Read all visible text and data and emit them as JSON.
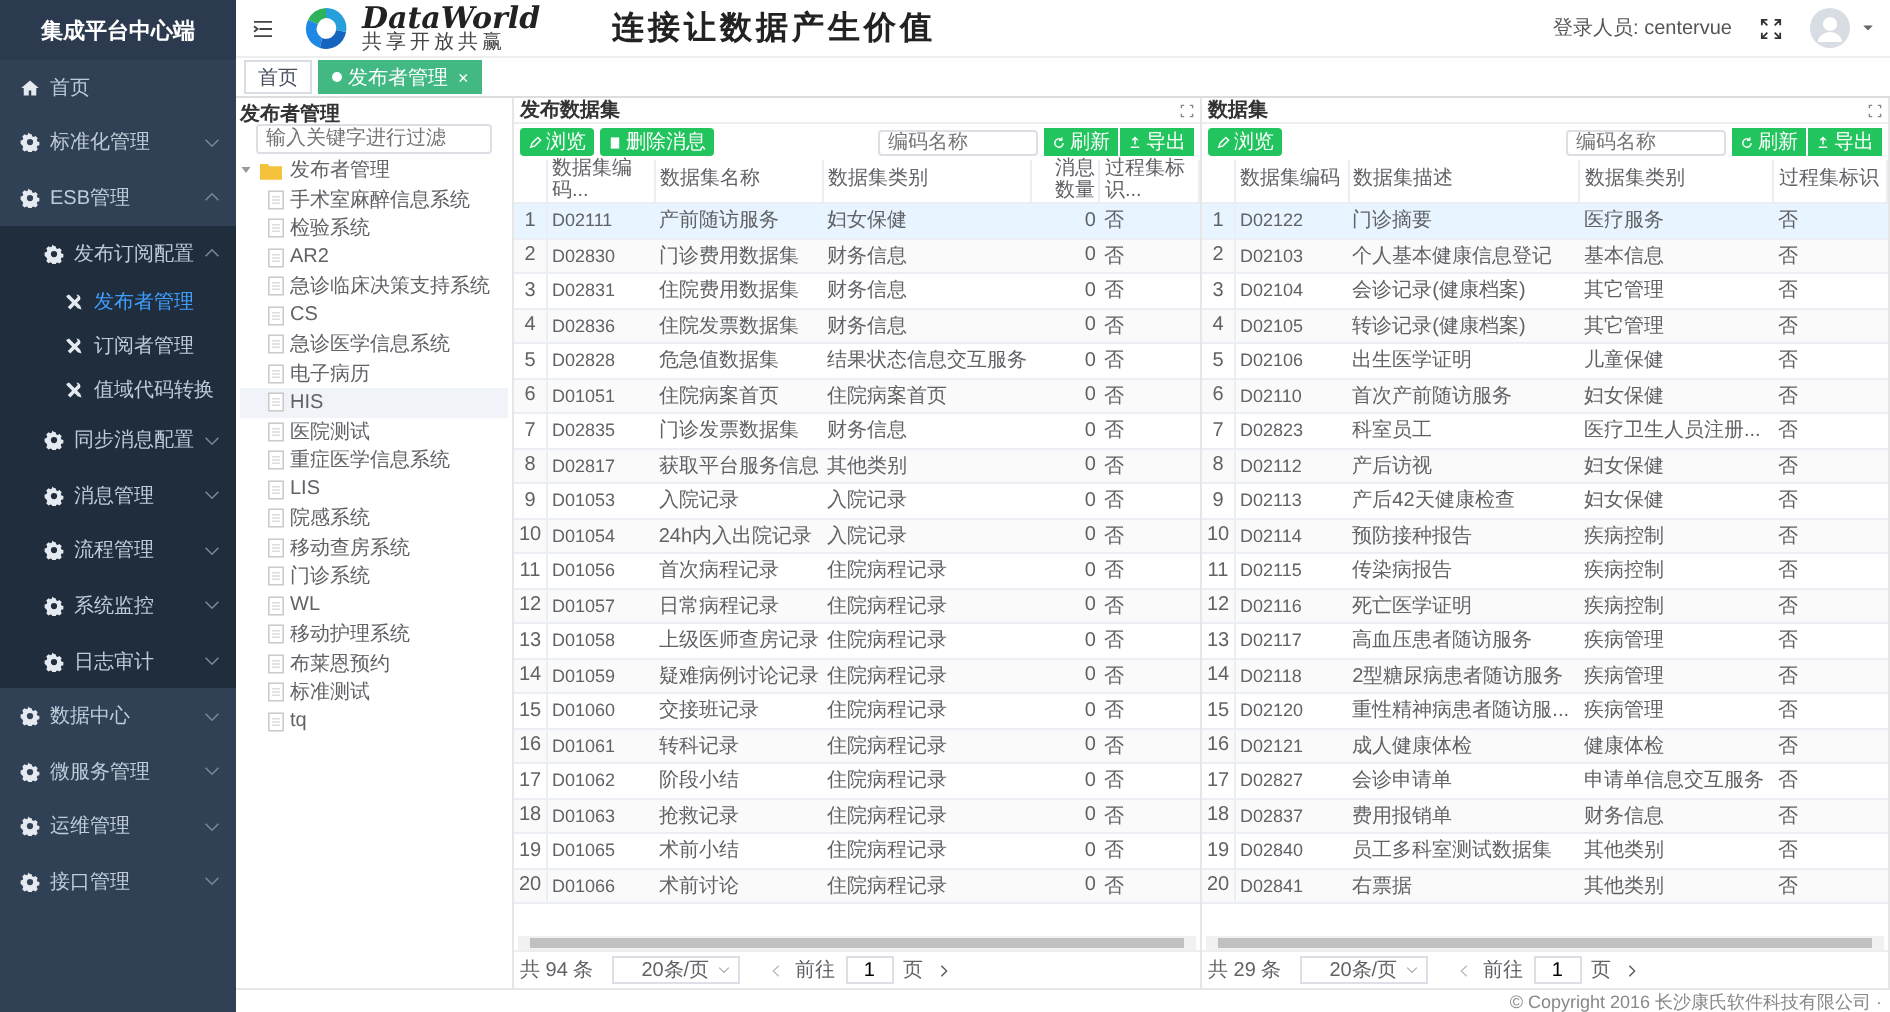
{
  "sidebar": {
    "title": "集成平台中心端",
    "items": [
      {
        "label": "首页",
        "kind": "leaf",
        "selected": false
      },
      {
        "label": "标准化管理",
        "kind": "group",
        "expanded": false,
        "selected": false
      },
      {
        "label": "ESB管理",
        "kind": "group",
        "expanded": true,
        "selected": false,
        "children": [
          {
            "label": "发布订阅配置",
            "kind": "group",
            "expanded": true,
            "selected": false,
            "children": [
              {
                "label": "发布者管理",
                "kind": "leaf",
                "selected": true
              },
              {
                "label": "订阅者管理",
                "kind": "leaf",
                "selected": false
              },
              {
                "label": "值域代码转换",
                "kind": "leaf",
                "selected": false
              }
            ]
          },
          {
            "label": "同步消息配置",
            "kind": "group",
            "expanded": false,
            "selected": false
          },
          {
            "label": "消息管理",
            "kind": "group",
            "expanded": false,
            "selected": false
          },
          {
            "label": "流程管理",
            "kind": "group",
            "expanded": false,
            "selected": false
          },
          {
            "label": "系统监控",
            "kind": "group",
            "expanded": false,
            "selected": false
          },
          {
            "label": "日志审计",
            "kind": "group",
            "expanded": false,
            "selected": false
          }
        ]
      },
      {
        "label": "数据中心",
        "kind": "group",
        "expanded": false,
        "selected": false
      },
      {
        "label": "微服务管理",
        "kind": "group",
        "expanded": false,
        "selected": false
      },
      {
        "label": "运维管理",
        "kind": "group",
        "expanded": false,
        "selected": false
      },
      {
        "label": "接口管理",
        "kind": "group",
        "expanded": false,
        "selected": false
      }
    ]
  },
  "header": {
    "logo_text": "DataWorld",
    "logo_subtitle": "共享开放共赢",
    "slogan": "连接让数据产生价值",
    "user_label": "登录人员: centervue"
  },
  "tabs": [
    {
      "label": "首页",
      "selected": false
    },
    {
      "label": "发布者管理",
      "selected": true,
      "close": "×"
    }
  ],
  "tree_panel": {
    "title": "发布者管理",
    "search": {
      "placeholder": "输入关键字进行过滤"
    },
    "tree": [
      {
        "label": "发布者管理",
        "expanded": true,
        "selected": false,
        "children": [
          {
            "label": "手术室麻醉信息系统",
            "selected": false
          },
          {
            "label": "检验系统",
            "selected": false
          },
          {
            "label": "AR2",
            "selected": false
          },
          {
            "label": "急诊临床决策支持系统",
            "selected": false
          },
          {
            "label": "CS",
            "selected": false
          },
          {
            "label": "急诊医学信息系统",
            "selected": false
          },
          {
            "label": "电子病历",
            "selected": false
          },
          {
            "label": "HIS",
            "selected": true
          },
          {
            "label": "医院测试",
            "selected": false
          },
          {
            "label": "重症医学信息系统",
            "selected": false
          },
          {
            "label": "LIS",
            "selected": false
          },
          {
            "label": "院感系统",
            "selected": false
          },
          {
            "label": "移动查房系统",
            "selected": false
          },
          {
            "label": "门诊系统",
            "selected": false
          },
          {
            "label": "WL",
            "selected": false
          },
          {
            "label": "移动护理系统",
            "selected": false
          },
          {
            "label": "布莱恩预约",
            "selected": false
          },
          {
            "label": "标准测试",
            "selected": false
          },
          {
            "label": "tq",
            "selected": false
          }
        ]
      }
    ]
  },
  "publish_panel": {
    "title": "发布数据集",
    "buttons": [
      {
        "label": "浏览",
        "kind": "edit"
      },
      {
        "label": "删除消息",
        "kind": "delete"
      }
    ],
    "search": {
      "placeholder": "编码名称"
    },
    "actions": [
      {
        "label": "刷新",
        "kind": "refresh"
      },
      {
        "label": "导出",
        "kind": "export"
      }
    ],
    "table": {
      "columns": [
        {
          "label": "数据集编码...",
          "kind": "text"
        },
        {
          "label": "数据集名称",
          "kind": "text"
        },
        {
          "label": "数据集类别",
          "kind": "text"
        },
        {
          "label": "消息数量",
          "kind": "number"
        },
        {
          "label": "过程集标识...",
          "kind": "text"
        }
      ],
      "rows": [
        {
          "index": "1",
          "selected": true,
          "cells": [
            "D02111",
            "产前随访服务",
            "妇女保健",
            "0",
            "否"
          ]
        },
        {
          "index": "2",
          "selected": false,
          "cells": [
            "D02830",
            "门诊费用数据集",
            "财务信息",
            "0",
            "否"
          ]
        },
        {
          "index": "3",
          "selected": false,
          "cells": [
            "D02831",
            "住院费用数据集",
            "财务信息",
            "0",
            "否"
          ]
        },
        {
          "index": "4",
          "selected": false,
          "cells": [
            "D02836",
            "住院发票数据集",
            "财务信息",
            "0",
            "否"
          ]
        },
        {
          "index": "5",
          "selected": false,
          "cells": [
            "D02828",
            "危急值数据集",
            "结果状态信息交互服务",
            "0",
            "否"
          ]
        },
        {
          "index": "6",
          "selected": false,
          "cells": [
            "D01051",
            "住院病案首页",
            "住院病案首页",
            "0",
            "否"
          ]
        },
        {
          "index": "7",
          "selected": false,
          "cells": [
            "D02835",
            "门诊发票数据集",
            "财务信息",
            "0",
            "否"
          ]
        },
        {
          "index": "8",
          "selected": false,
          "cells": [
            "D02817",
            "获取平台服务信息",
            "其他类别",
            "0",
            "否"
          ]
        },
        {
          "index": "9",
          "selected": false,
          "cells": [
            "D01053",
            "入院记录",
            "入院记录",
            "0",
            "否"
          ]
        },
        {
          "index": "10",
          "selected": false,
          "cells": [
            "D01054",
            "24h内入出院记录",
            "入院记录",
            "0",
            "否"
          ]
        },
        {
          "index": "11",
          "selected": false,
          "cells": [
            "D01056",
            "首次病程记录",
            "住院病程记录",
            "0",
            "否"
          ]
        },
        {
          "index": "12",
          "selected": false,
          "cells": [
            "D01057",
            "日常病程记录",
            "住院病程记录",
            "0",
            "否"
          ]
        },
        {
          "index": "13",
          "selected": false,
          "cells": [
            "D01058",
            "上级医师查房记录",
            "住院病程记录",
            "0",
            "否"
          ]
        },
        {
          "index": "14",
          "selected": false,
          "cells": [
            "D01059",
            "疑难病例讨论记录",
            "住院病程记录",
            "0",
            "否"
          ]
        },
        {
          "index": "15",
          "selected": false,
          "cells": [
            "D01060",
            "交接班记录",
            "住院病程记录",
            "0",
            "否"
          ]
        },
        {
          "index": "16",
          "selected": false,
          "cells": [
            "D01061",
            "转科记录",
            "住院病程记录",
            "0",
            "否"
          ]
        },
        {
          "index": "17",
          "selected": false,
          "cells": [
            "D01062",
            "阶段小结",
            "住院病程记录",
            "0",
            "否"
          ]
        },
        {
          "index": "18",
          "selected": false,
          "cells": [
            "D01063",
            "抢救记录",
            "住院病程记录",
            "0",
            "否"
          ]
        },
        {
          "index": "19",
          "selected": false,
          "cells": [
            "D01065",
            "术前小结",
            "住院病程记录",
            "0",
            "否"
          ]
        },
        {
          "index": "20",
          "selected": false,
          "cells": [
            "D01066",
            "术前讨论",
            "住院病程记录",
            "0",
            "否"
          ]
        }
      ]
    },
    "pagination": {
      "total": "共 94 条",
      "page_size": "20条/页",
      "goto_label": "前往",
      "page": "1",
      "page_suffix": "页"
    }
  },
  "dataset_panel": {
    "title": "数据集",
    "buttons": [
      {
        "label": "浏览",
        "kind": "edit"
      }
    ],
    "search": {
      "placeholder": "编码名称"
    },
    "actions": [
      {
        "label": "刷新",
        "kind": "refresh"
      },
      {
        "label": "导出",
        "kind": "export"
      }
    ],
    "table": {
      "columns": [
        {
          "label": "数据集编码",
          "kind": "text"
        },
        {
          "label": "数据集描述",
          "kind": "text"
        },
        {
          "label": "数据集类别",
          "kind": "text"
        },
        {
          "label": "过程集标识",
          "kind": "text"
        }
      ],
      "rows": [
        {
          "index": "1",
          "selected": true,
          "cells": [
            "D02122",
            "门诊摘要",
            "医疗服务",
            "否"
          ]
        },
        {
          "index": "2",
          "selected": false,
          "cells": [
            "D02103",
            "个人基本健康信息登记",
            "基本信息",
            "否"
          ]
        },
        {
          "index": "3",
          "selected": false,
          "cells": [
            "D02104",
            "会诊记录(健康档案)",
            "其它管理",
            "否"
          ]
        },
        {
          "index": "4",
          "selected": false,
          "cells": [
            "D02105",
            "转诊记录(健康档案)",
            "其它管理",
            "否"
          ]
        },
        {
          "index": "5",
          "selected": false,
          "cells": [
            "D02106",
            "出生医学证明",
            "儿童保健",
            "否"
          ]
        },
        {
          "index": "6",
          "selected": false,
          "cells": [
            "D02110",
            "首次产前随访服务",
            "妇女保健",
            "否"
          ]
        },
        {
          "index": "7",
          "selected": false,
          "cells": [
            "D02823",
            "科室员工",
            "医疗卫生人员注册...",
            "否"
          ]
        },
        {
          "index": "8",
          "selected": false,
          "cells": [
            "D02112",
            "产后访视",
            "妇女保健",
            "否"
          ]
        },
        {
          "index": "9",
          "selected": false,
          "cells": [
            "D02113",
            "产后42天健康检查",
            "妇女保健",
            "否"
          ]
        },
        {
          "index": "10",
          "selected": false,
          "cells": [
            "D02114",
            "预防接种报告",
            "疾病控制",
            "否"
          ]
        },
        {
          "index": "11",
          "selected": false,
          "cells": [
            "D02115",
            "传染病报告",
            "疾病控制",
            "否"
          ]
        },
        {
          "index": "12",
          "selected": false,
          "cells": [
            "D02116",
            "死亡医学证明",
            "疾病控制",
            "否"
          ]
        },
        {
          "index": "13",
          "selected": false,
          "cells": [
            "D02117",
            "高血压患者随访服务",
            "疾病管理",
            "否"
          ]
        },
        {
          "index": "14",
          "selected": false,
          "cells": [
            "D02118",
            "2型糖尿病患者随访服务",
            "疾病管理",
            "否"
          ]
        },
        {
          "index": "15",
          "selected": false,
          "cells": [
            "D02120",
            "重性精神病患者随访服...",
            "疾病管理",
            "否"
          ]
        },
        {
          "index": "16",
          "selected": false,
          "cells": [
            "D02121",
            "成人健康体检",
            "健康体检",
            "否"
          ]
        },
        {
          "index": "17",
          "selected": false,
          "cells": [
            "D02827",
            "会诊申请单",
            "申请单信息交互服务",
            "否"
          ]
        },
        {
          "index": "18",
          "selected": false,
          "cells": [
            "D02837",
            "费用报销单",
            "财务信息",
            "否"
          ]
        },
        {
          "index": "19",
          "selected": false,
          "cells": [
            "D02840",
            "员工多科室测试数据集",
            "其他类别",
            "否"
          ]
        },
        {
          "index": "20",
          "selected": false,
          "cells": [
            "D02841",
            "右票据",
            "其他类别",
            "否"
          ]
        }
      ]
    },
    "pagination": {
      "total": "共 29 条",
      "page_size": "20条/页",
      "goto_label": "前往",
      "page": "1",
      "page_suffix": "页"
    }
  },
  "footer": "© Copyright 2016 长沙康氏软件科技有限公司 ·"
}
